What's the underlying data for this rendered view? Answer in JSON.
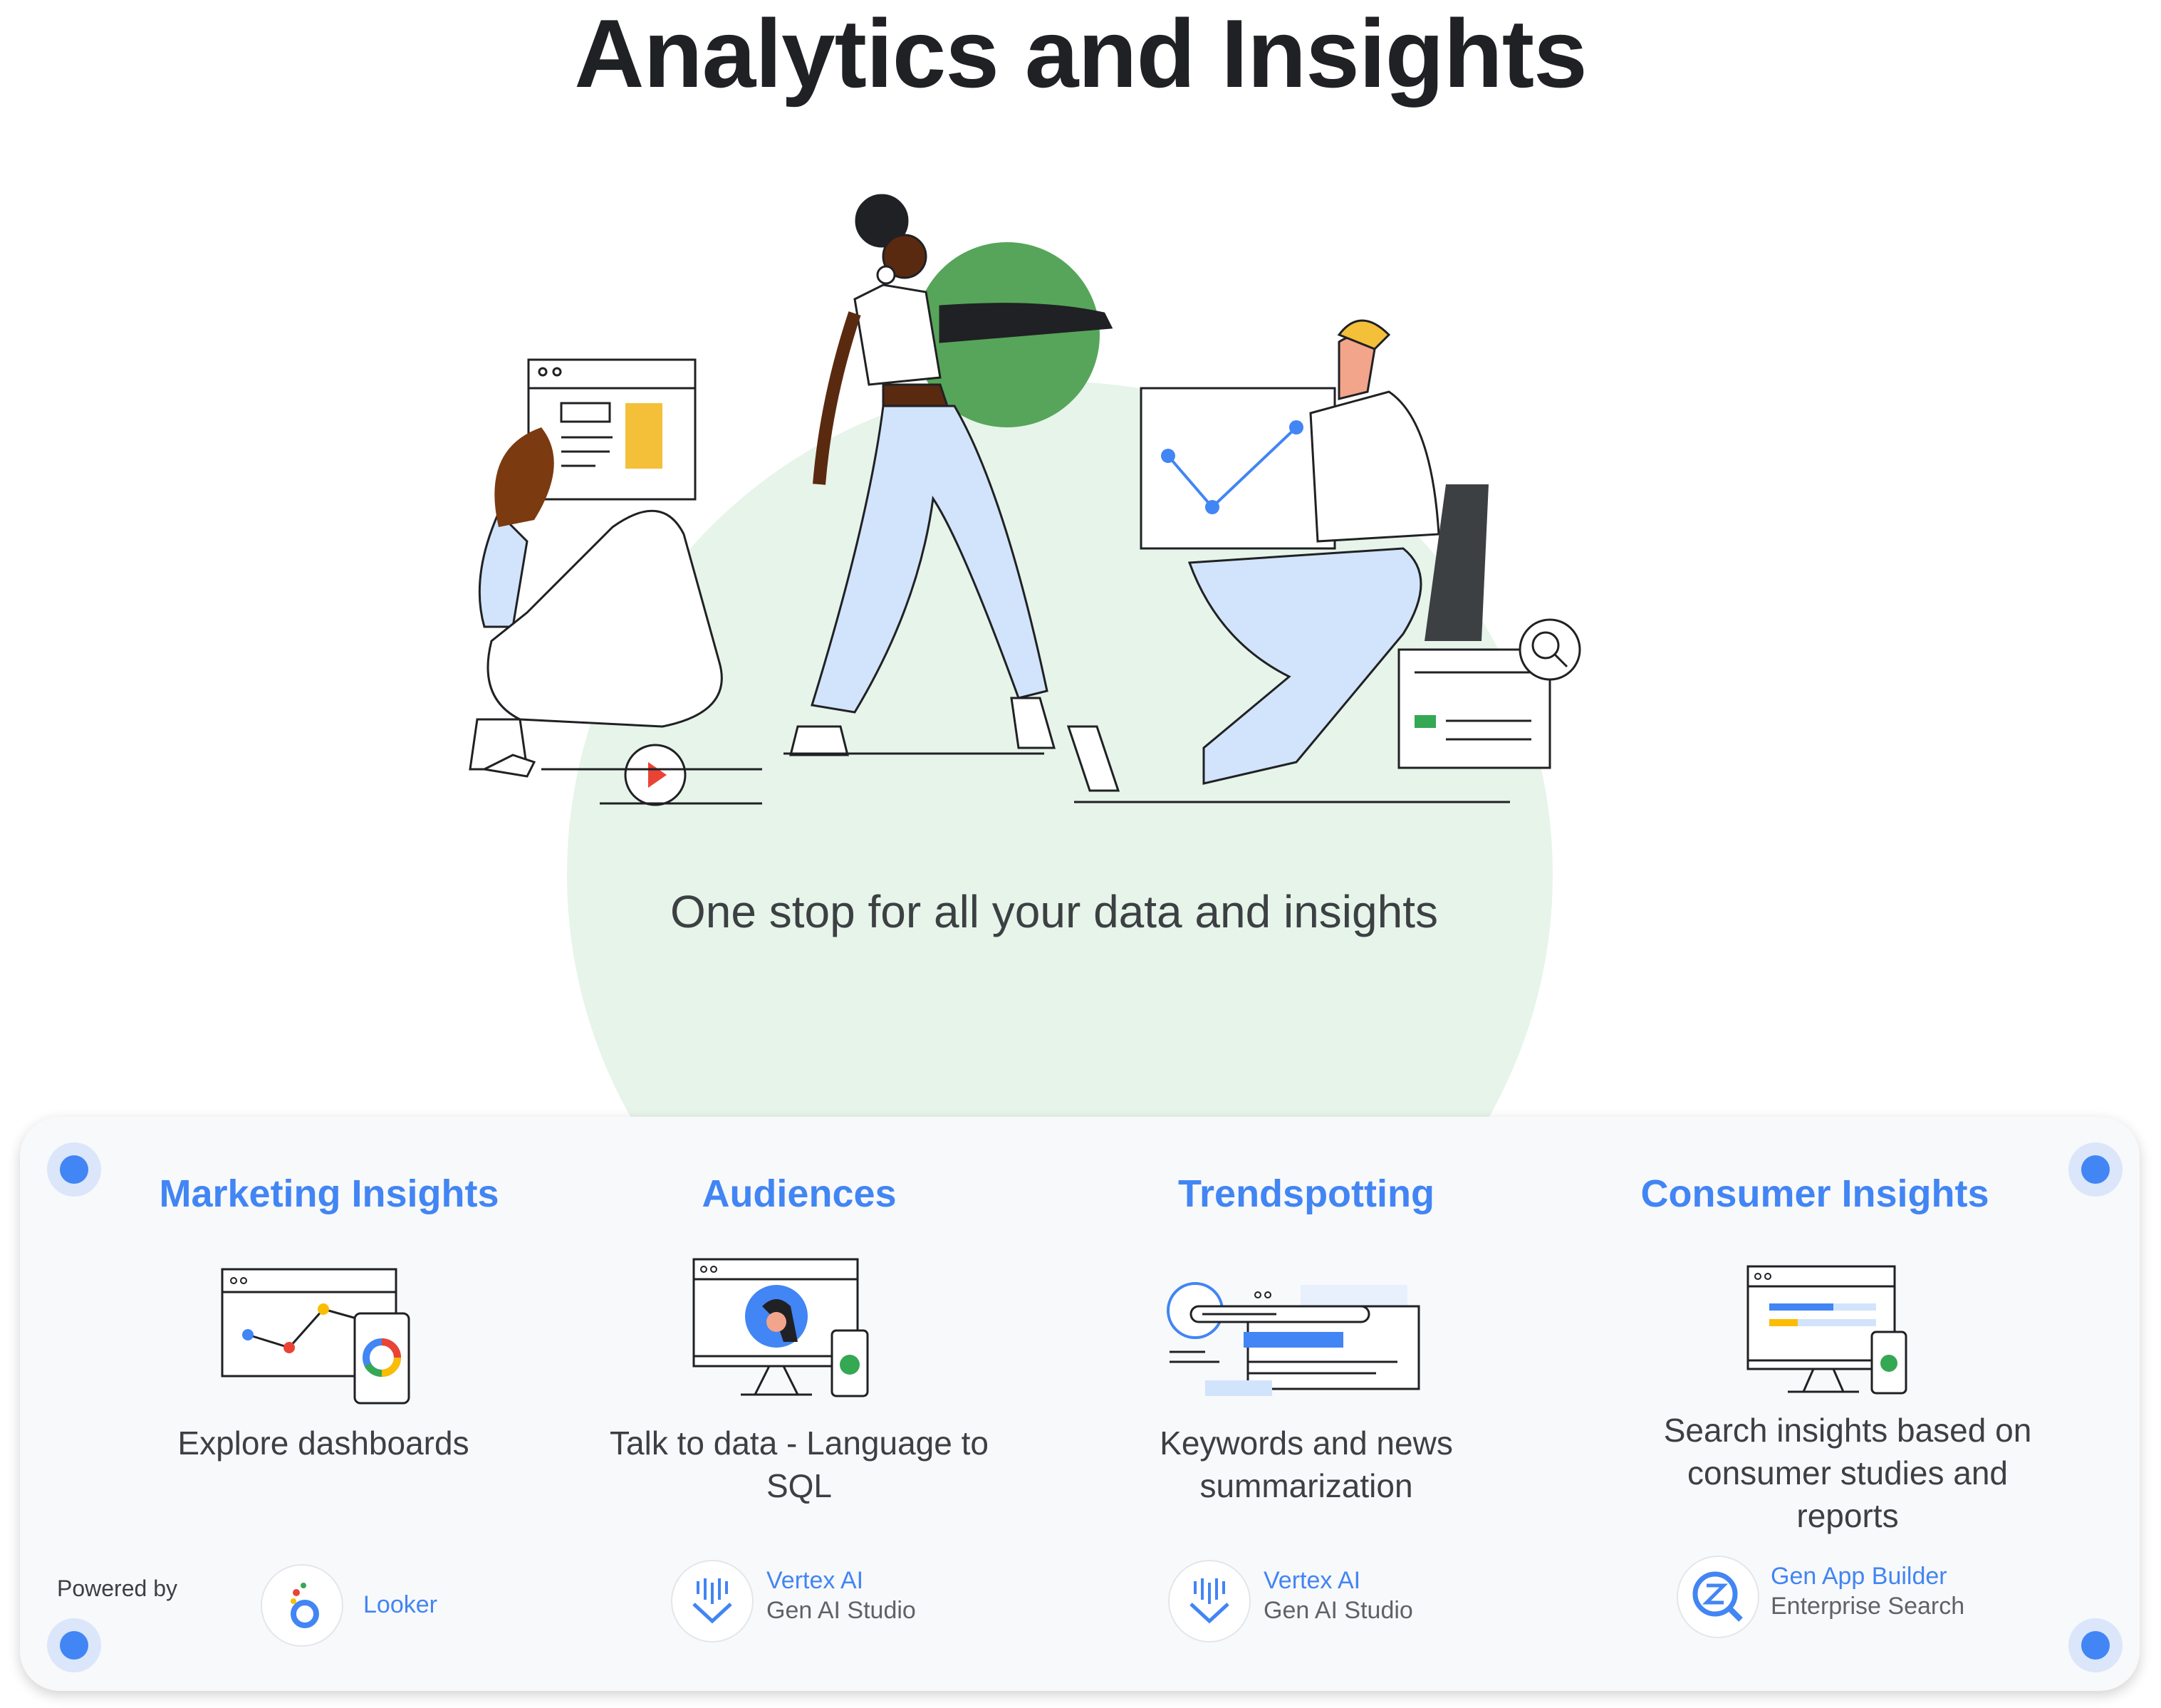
{
  "title": "Analytics and Insights",
  "tagline": "One stop for all your data and insights",
  "colors": {
    "accent": "#4285f4",
    "green": "#34a853",
    "bg_circle": "#e6f4ea",
    "yellow": "#fbbc04",
    "red": "#ea4335",
    "panel": "#f8f9fa"
  },
  "columns": [
    {
      "title": "Marketing Insights",
      "description": "Explore dashboards",
      "icon": "dashboard-icon"
    },
    {
      "title": "Audiences",
      "description": "Talk to data - Language to SQL",
      "icon": "monitor-person-icon"
    },
    {
      "title": "Trendspotting",
      "description": "Keywords and news summarization",
      "icon": "search-news-icon"
    },
    {
      "title": "Consumer Insights",
      "description": "Search insights based on consumer studies and reports",
      "icon": "monitor-report-icon"
    }
  ],
  "powered_by_label": "Powered by",
  "brands": [
    {
      "primary": "Looker",
      "secondary": "",
      "icon": "looker-icon"
    },
    {
      "primary": "Vertex AI",
      "secondary": "Gen AI Studio",
      "icon": "vertex-ai-icon"
    },
    {
      "primary": "Vertex AI",
      "secondary": "Gen AI Studio",
      "icon": "vertex-ai-icon"
    },
    {
      "primary": "Gen App Builder",
      "secondary": "Enterprise Search",
      "icon": "gen-app-builder-icon"
    }
  ]
}
